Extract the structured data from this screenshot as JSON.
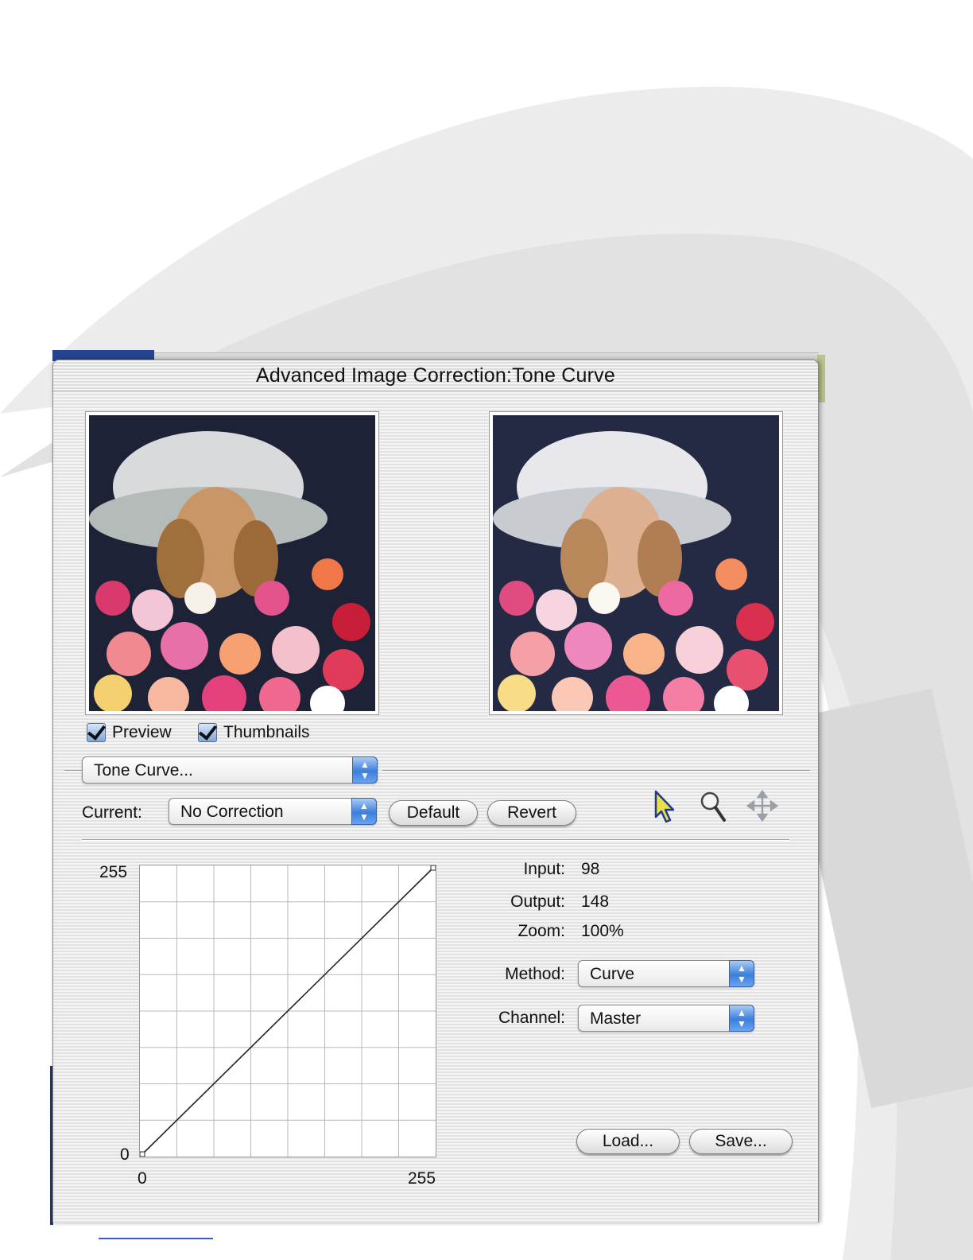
{
  "window": {
    "title": "Advanced Image Correction:Tone Curve"
  },
  "options": {
    "preview_label": "Preview",
    "preview_checked": true,
    "thumbnails_label": "Thumbnails",
    "thumbnails_checked": true
  },
  "correction_popup": {
    "value": "Tone Curve..."
  },
  "current": {
    "label": "Current:",
    "value": "No Correction",
    "default_label": "Default",
    "revert_label": "Revert"
  },
  "tools": [
    {
      "icon": "arrow-pointer-icon"
    },
    {
      "icon": "magnifier-icon"
    },
    {
      "icon": "move-icon"
    }
  ],
  "curve": {
    "y_max_label": "255",
    "y_min_label": "0",
    "x_min_label": "0",
    "x_max_label": "255",
    "points": [
      [
        0,
        0
      ],
      [
        255,
        255
      ]
    ]
  },
  "readout": {
    "input_label": "Input:",
    "input_value": "98",
    "output_label": "Output:",
    "output_value": "148",
    "zoom_label": "Zoom:",
    "zoom_value": "100%"
  },
  "method": {
    "label": "Method:",
    "value": "Curve"
  },
  "channel": {
    "label": "Channel:",
    "value": "Master"
  },
  "buttons": {
    "load_label": "Load...",
    "save_label": "Save..."
  },
  "colors": {
    "accent_blue": "#3b7fdc",
    "window_bg": "#ececec"
  }
}
